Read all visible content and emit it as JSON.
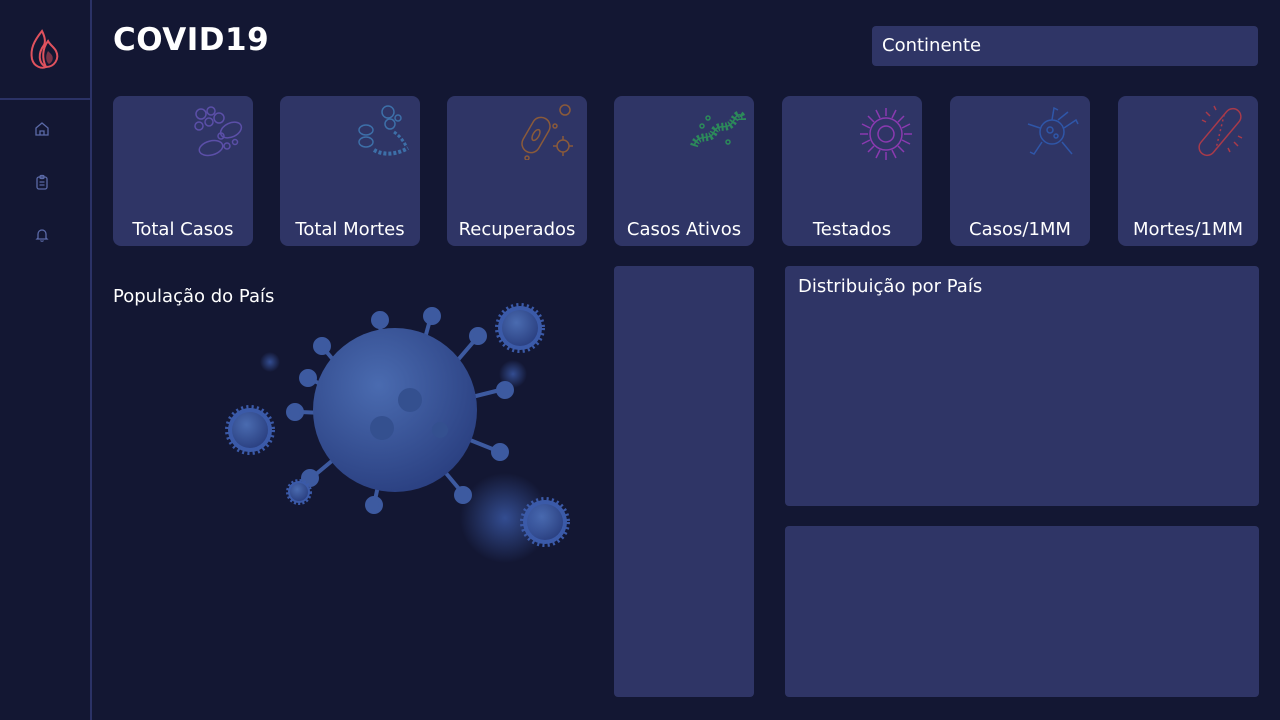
{
  "app": {
    "title": "COVID19"
  },
  "filter": {
    "label": "Continente"
  },
  "cards": [
    {
      "label": "Total Casos",
      "icon": "bacteria-cluster-icon",
      "color": "#5b4fa8"
    },
    {
      "label": "Total Mortes",
      "icon": "bacteria-chain-icon",
      "color": "#3d6fa8"
    },
    {
      "label": "Recuperados",
      "icon": "bacillus-icon",
      "color": "#8a5a3a"
    },
    {
      "label": "Casos Ativos",
      "icon": "spirillum-icon",
      "color": "#2c8a5a"
    },
    {
      "label": "Testados",
      "icon": "spiky-virus-icon",
      "color": "#8a3ab0"
    },
    {
      "label": "Casos/1MM",
      "icon": "virus-icon",
      "color": "#2f56a8"
    },
    {
      "label": "Mortes/1MM",
      "icon": "rod-bacterium-icon",
      "color": "#a83a4a"
    }
  ],
  "sections": {
    "population": "População do País",
    "distribution": "Distribuição por País"
  },
  "colors": {
    "background": "#131733",
    "panel": "#2f3566",
    "logo": "#e0525e"
  }
}
